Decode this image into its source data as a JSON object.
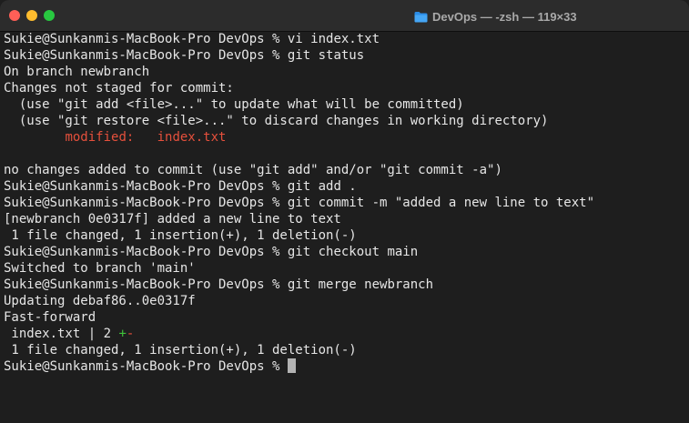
{
  "window": {
    "title": "DevOps — -zsh — 119×33",
    "folder_icon": "folder-icon",
    "colors": {
      "background": "#1e1e1e",
      "text": "#e6e6e6",
      "modified": "#e5503c",
      "insertion": "#3fc23a",
      "deletion": "#e5503c"
    }
  },
  "terminal": {
    "prompt": "Sukie@Sunkanmis-MacBook-Pro DevOps %",
    "lines": [
      {
        "type": "command",
        "command": "vi index.txt"
      },
      {
        "type": "command",
        "command": "git status"
      },
      {
        "type": "output",
        "text": "On branch newbranch"
      },
      {
        "type": "output",
        "text": "Changes not staged for commit:"
      },
      {
        "type": "output",
        "text": "  (use \"git add <file>...\" to update what will be committed)"
      },
      {
        "type": "output",
        "text": "  (use \"git restore <file>...\" to discard changes in working directory)"
      },
      {
        "type": "modified",
        "label": "modified:",
        "file": "index.txt"
      },
      {
        "type": "blank",
        "text": ""
      },
      {
        "type": "output",
        "text": "no changes added to commit (use \"git add\" and/or \"git commit -a\")"
      },
      {
        "type": "command",
        "command": "git add ."
      },
      {
        "type": "command",
        "command": "git commit -m \"added a new line to text\""
      },
      {
        "type": "output",
        "text": "[newbranch 0e0317f] added a new line to text"
      },
      {
        "type": "output",
        "text": " 1 file changed, 1 insertion(+), 1 deletion(-)"
      },
      {
        "type": "command",
        "command": "git checkout main"
      },
      {
        "type": "output",
        "text": "Switched to branch 'main'"
      },
      {
        "type": "command",
        "command": "git merge newbranch"
      },
      {
        "type": "output",
        "text": "Updating debaf86..0e0317f"
      },
      {
        "type": "output",
        "text": "Fast-forward"
      },
      {
        "type": "diffstat",
        "file": " index.txt | 2 ",
        "plus": "+",
        "minus": "-"
      },
      {
        "type": "output",
        "text": " 1 file changed, 1 insertion(+), 1 deletion(-)"
      },
      {
        "type": "cursor"
      }
    ]
  }
}
